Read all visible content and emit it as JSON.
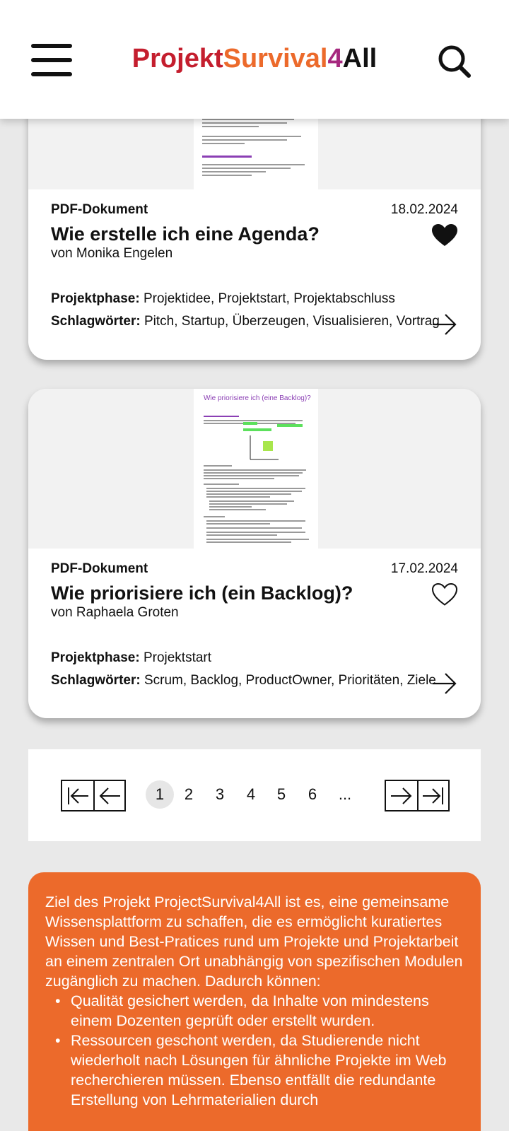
{
  "header": {
    "logo_part1": "Projekt",
    "logo_part2": "Survival",
    "logo_part3": "4",
    "logo_part4": "All",
    "menu_icon": "hamburger-menu-icon",
    "search_icon": "search-icon"
  },
  "cards": [
    {
      "doc_type": "PDF-Dokument",
      "date": "18.02.2024",
      "title": "Wie erstelle ich eine Agenda?",
      "author": "von Monika Engelen",
      "favorited": true,
      "phase_label": "Projektphase:",
      "phase_value": "Projektidee, Projektstart, Projektabschluss",
      "tags_label": "Schlagwörter:",
      "tags_value": "Pitch, Startup, Überzeugen, Visualisieren, Vortrag"
    },
    {
      "doc_type": "PDF-Dokument",
      "date": "17.02.2024",
      "title": "Wie priorisiere ich (ein Backlog)?",
      "author": "von Raphaela Groten",
      "favorited": false,
      "phase_label": "Projektphase:",
      "phase_value": "Projektstart",
      "tags_label": "Schlagwörter:",
      "tags_value": "Scrum, Backlog, ProductOwner, Prioritäten, Ziele",
      "thumb_title": "Wie priorisiere ich (eine Backlog)?"
    }
  ],
  "pagination": {
    "pages": [
      "1",
      "2",
      "3",
      "4",
      "5",
      "6",
      "..."
    ],
    "current": "1"
  },
  "info": {
    "intro": "Ziel des Projekt ProjectSurvival4All ist es, eine gemeinsame Wissensplattform zu schaffen, die es ermöglicht kuratiertes Wissen und Best-Pratices rund um Projekte und Projektarbeit an einem zentralen Ort unabhängig von spezifischen Modulen zugänglich zu machen. Dadurch können:",
    "bullets": [
      "Qualität gesichert werden, da Inhalte von mindestens einem Dozenten geprüft oder erstellt wurden.",
      "Ressourcen geschont werden, da Studierende nicht wiederholt nach Lösungen für ähnliche Projekte im Web recherchieren müssen. Ebenso entfällt die redundante Erstellung von Lehrmaterialien durch"
    ]
  },
  "colors": {
    "accent_orange": "#ec6a2b",
    "logo_red": "#c41e2e",
    "logo_purple": "#a6287f",
    "background": "#e9e9e9"
  }
}
